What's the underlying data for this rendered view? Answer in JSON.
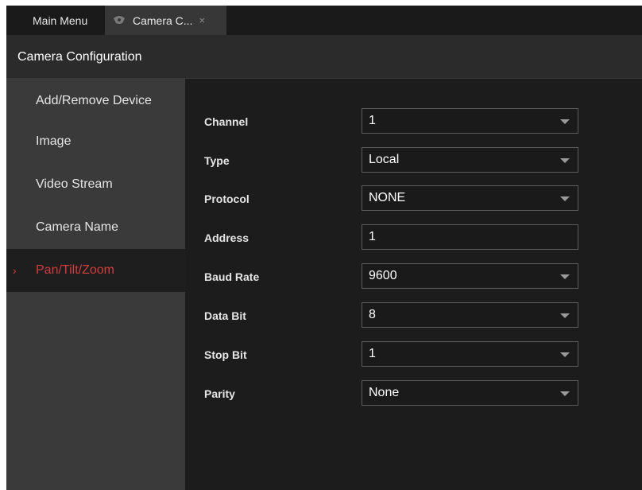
{
  "tabs": {
    "main_menu": "Main Menu",
    "camera": "Camera C...",
    "close": "×"
  },
  "header": {
    "title": "Camera Configuration"
  },
  "sidebar": {
    "items": [
      {
        "label": "Add/Remove Device"
      },
      {
        "label": "Image"
      },
      {
        "label": "Video Stream"
      },
      {
        "label": "Camera Name"
      },
      {
        "label": "Pan/Tilt/Zoom",
        "active": true
      }
    ]
  },
  "form": {
    "channel": {
      "label": "Channel",
      "value": "1"
    },
    "type": {
      "label": "Type",
      "value": "Local"
    },
    "protocol": {
      "label": "Protocol",
      "value": "NONE"
    },
    "address": {
      "label": "Address",
      "value": "1"
    },
    "baud_rate": {
      "label": "Baud Rate",
      "value": "9600"
    },
    "data_bit": {
      "label": "Data Bit",
      "value": "8"
    },
    "stop_bit": {
      "label": "Stop Bit",
      "value": "1"
    },
    "parity": {
      "label": "Parity",
      "value": "None"
    }
  },
  "colors": {
    "accent": "#d23c3c",
    "background": "#1c1c1c",
    "sidebar": "#3a3a3a"
  }
}
